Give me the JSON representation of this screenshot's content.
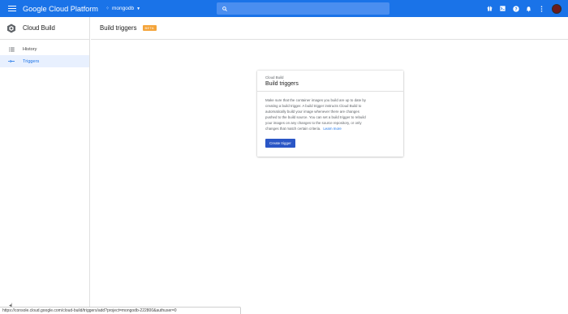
{
  "topbar": {
    "app_title": "Google Cloud Platform",
    "project_name": "mongodb",
    "icons": [
      "gift-icon",
      "cloud-shell-icon",
      "help-icon",
      "notifications-icon",
      "more-vert-icon"
    ],
    "brand_color": "#1a73e8"
  },
  "sidebar": {
    "title": "Cloud Build",
    "items": [
      {
        "label": "History",
        "icon": "list-icon",
        "active": false
      },
      {
        "label": "Triggers",
        "icon": "triggers-icon",
        "active": true
      }
    ],
    "collapse_glyph": "◂|"
  },
  "header": {
    "title": "Build triggers",
    "badge": "BETA"
  },
  "card": {
    "eyebrow": "Cloud Build",
    "title": "Build triggers",
    "body_lines": [
      "Make sure that the container images you build are up to date by",
      "creating a build trigger. A build trigger instructs Cloud Build to",
      "automatically build your image whenever there are changes",
      "pushed to the build source. You can set a build trigger to rebuild",
      "your images on any changes to the source repository, or only",
      "changes that match certain criteria."
    ],
    "learn_more": "Learn more",
    "button": "Create trigger"
  },
  "status_url": "https://console.cloud.google.com/cloud-build/triggers/add?project=mongodb-222800&authuser=0"
}
